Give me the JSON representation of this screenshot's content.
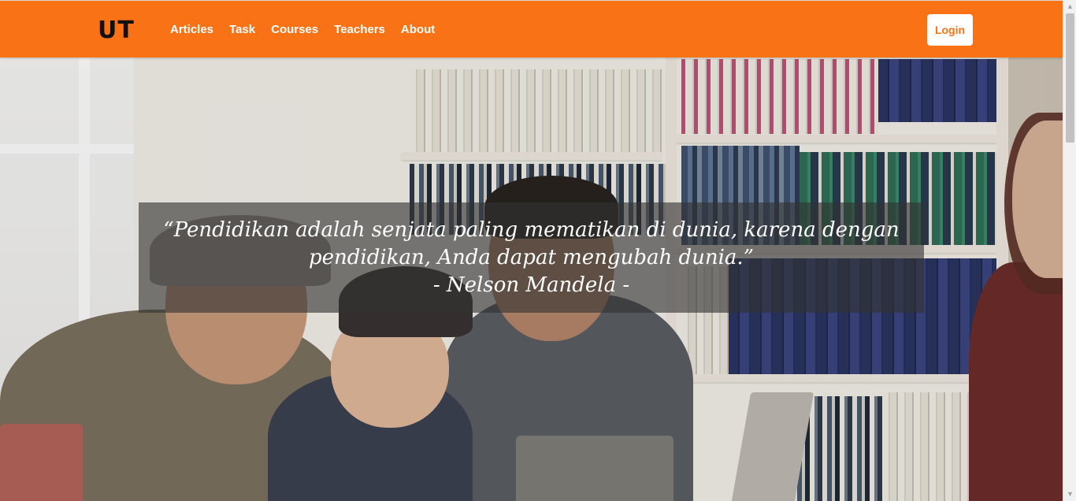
{
  "navbar": {
    "brand": "UT",
    "links": [
      {
        "label": "Articles"
      },
      {
        "label": "Task"
      },
      {
        "label": "Courses"
      },
      {
        "label": "Teachers"
      },
      {
        "label": "About"
      }
    ],
    "login_label": "Login"
  },
  "hero": {
    "quote": "“Pendidikan adalah senjata paling mematikan di dunia, karena dengan pendidikan, Anda dapat mengubah dunia.”",
    "author": "- Nelson Mandela -"
  },
  "scrollbar": {
    "up_icon": "▲",
    "down_icon": "▼"
  },
  "colors": {
    "navbar_bg": "#f97316",
    "login_text": "#f97316",
    "quote_overlay": "rgba(50,50,50,0.62)"
  }
}
